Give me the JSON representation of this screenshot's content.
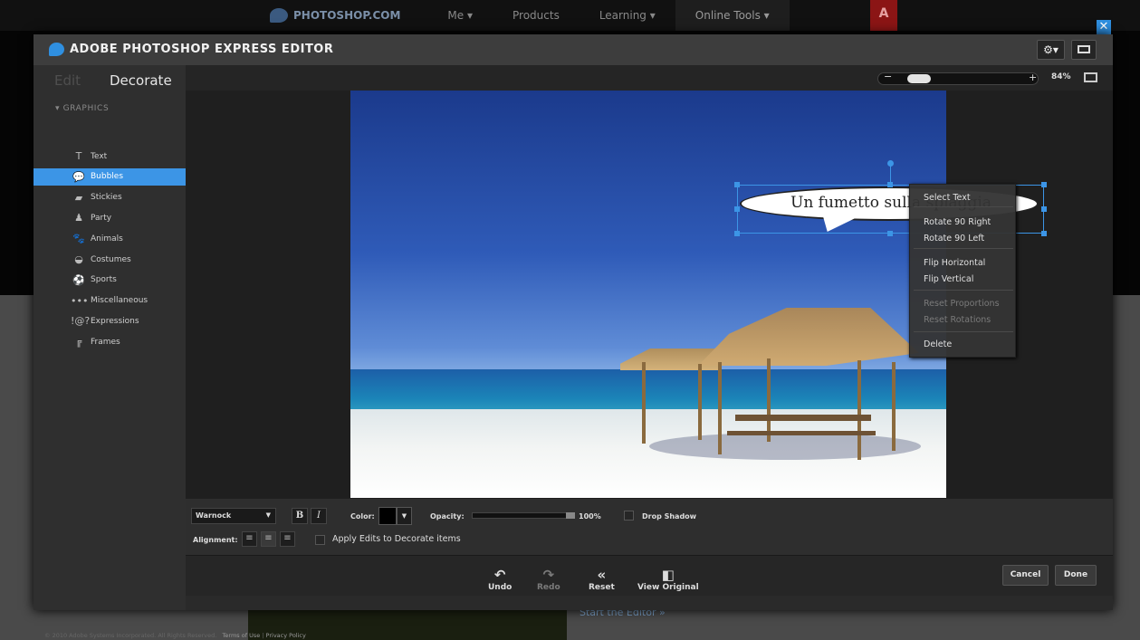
{
  "site": {
    "brand": "PHOTOSHOP.COM",
    "nav": [
      "Me ▾",
      "Products",
      "Learning ▾",
      "Online Tools ▾"
    ],
    "adobe_logo": "A",
    "link": "Start the Editor »"
  },
  "editor": {
    "title": "ADOBE PHOTOSHOP EXPRESS EDITOR",
    "settings_label": "⚙▾",
    "tabs": {
      "edit": "Edit",
      "decorate": "Decorate"
    },
    "section": "GRAPHICS",
    "graphics": [
      {
        "label": "Text",
        "icon": "T"
      },
      {
        "label": "Bubbles",
        "icon": "💬"
      },
      {
        "label": "Stickies",
        "icon": "▰"
      },
      {
        "label": "Party",
        "icon": "♟"
      },
      {
        "label": "Animals",
        "icon": "🐾"
      },
      {
        "label": "Costumes",
        "icon": "◒"
      },
      {
        "label": "Sports",
        "icon": "⚽"
      },
      {
        "label": "Miscellaneous",
        "icon": "•••"
      },
      {
        "label": "Expressions",
        "icon": "!@?"
      },
      {
        "label": "Frames",
        "icon": "╔"
      }
    ],
    "selected_item": "Bubbles",
    "zoom": {
      "value": "84%",
      "minus": "−",
      "plus": "+",
      "level": 0.15
    },
    "bubble_text": "Un fumetto sulla spiaggia",
    "context_menu": {
      "items": [
        {
          "label": "Select Text",
          "enabled": true
        },
        {
          "label": "Rotate 90 Right",
          "enabled": true
        },
        {
          "label": "Rotate 90 Left",
          "enabled": true
        },
        {
          "label": "Flip Horizontal",
          "enabled": true
        },
        {
          "label": "Flip Vertical",
          "enabled": true
        },
        {
          "label": "Reset Proportions",
          "enabled": false
        },
        {
          "label": "Reset Rotations",
          "enabled": false
        },
        {
          "label": "Delete",
          "enabled": true
        }
      ]
    },
    "props": {
      "font": "Warnock",
      "bold": "B",
      "italic": "I",
      "color_label": "Color:",
      "color_value": "#000000",
      "opacity_label": "Opacity:",
      "opacity_value": "100%",
      "drop_shadow_label": "Drop Shadow",
      "alignment_label": "Alignment:",
      "apply_edits_label": "Apply Edits to Decorate items"
    },
    "actions": {
      "undo": "Undo",
      "redo": "Redo",
      "reset": "Reset",
      "view_original": "View Original",
      "cancel": "Cancel",
      "done": "Done"
    },
    "footer": {
      "copyright": "© 2010 Adobe Systems Incorporated. All Rights Reserved.",
      "terms": "Terms of Use",
      "privacy": "Privacy Policy"
    }
  },
  "colors": {
    "accent": "#3c95e6",
    "panel": "#2f2f2f",
    "titlebar": "#3d3d3d"
  }
}
